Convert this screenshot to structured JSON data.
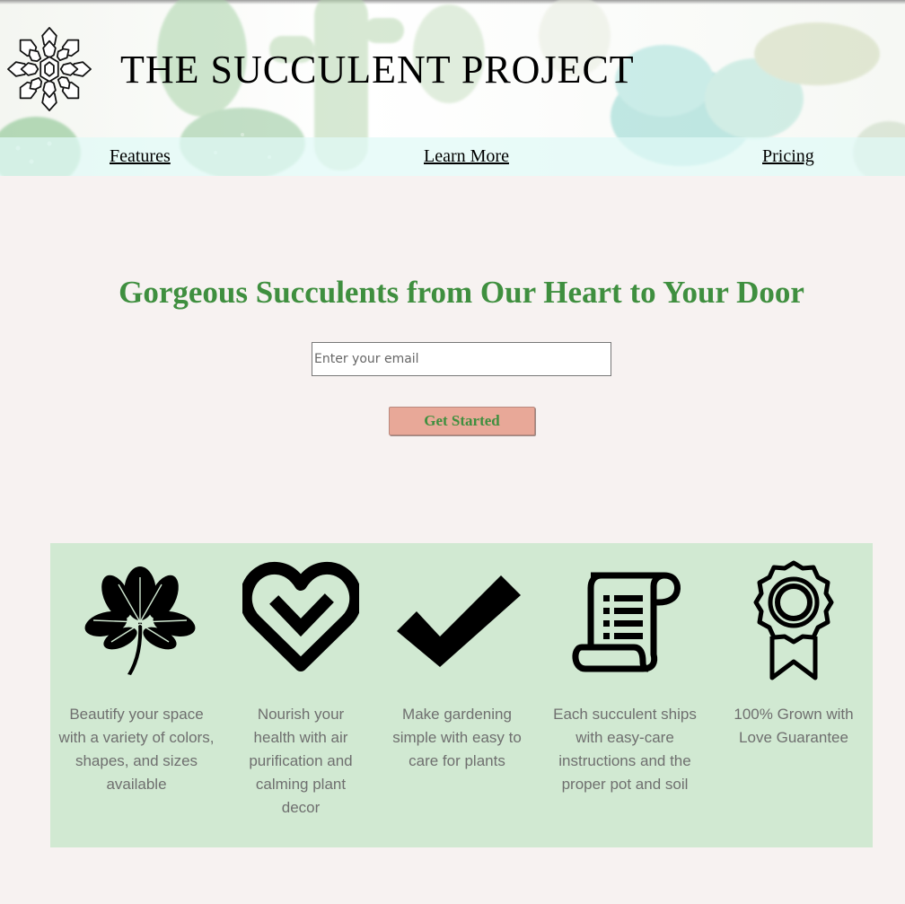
{
  "header": {
    "title": "THE SUCCULENT PROJECT",
    "logo_icon": "succulent-logo-icon"
  },
  "nav": {
    "items": [
      {
        "label": "Features"
      },
      {
        "label": "Learn More"
      },
      {
        "label": "Pricing"
      }
    ]
  },
  "hero": {
    "heading": "Gorgeous Succulents from Our Heart to Your Door",
    "email_placeholder": "Enter your email",
    "button_label": "Get Started"
  },
  "features": [
    {
      "icon": "clover-leaf-icon",
      "text": "Beautify your space with a variety of colors, shapes, and sizes available"
    },
    {
      "icon": "heart-check-icon",
      "text": "Nourish your health with air purification and calming plant decor"
    },
    {
      "icon": "checkmark-icon",
      "text": "Make gardening simple with easy to care for plants"
    },
    {
      "icon": "scroll-list-icon",
      "text": "Each succulent ships with easy-care instructions and the proper pot and soil"
    },
    {
      "icon": "award-ribbon-icon",
      "text": "100% Grown with Love Guarantee"
    }
  ],
  "colors": {
    "page_background": "#f7f2f1",
    "heading_green": "#3f8f3f",
    "button_background": "#e8a898",
    "features_background": "#d1e9d2",
    "nav_band": "#e1faf7"
  }
}
